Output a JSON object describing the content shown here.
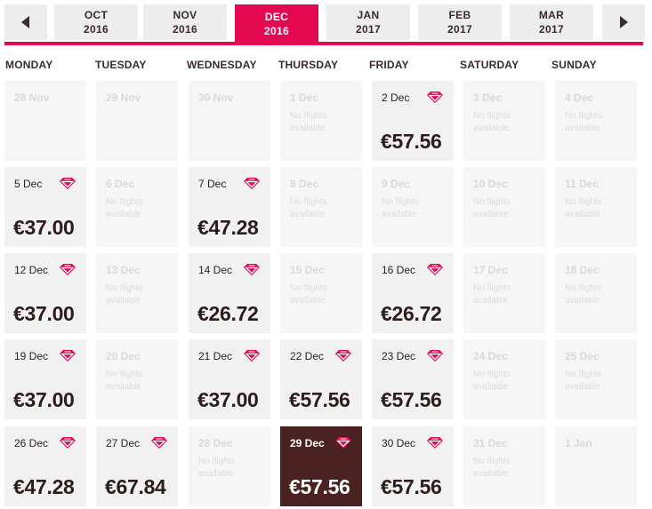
{
  "nav": {
    "prev_icon": "chevron-left-icon",
    "next_icon": "chevron-right-icon",
    "months": [
      {
        "month": "OCT",
        "year": "2016",
        "active": false
      },
      {
        "month": "NOV",
        "year": "2016",
        "active": false
      },
      {
        "month": "DEC",
        "year": "2016",
        "active": true
      },
      {
        "month": "JAN",
        "year": "2017",
        "active": false
      },
      {
        "month": "FEB",
        "year": "2017",
        "active": false
      },
      {
        "month": "MAR",
        "year": "2017",
        "active": false
      }
    ]
  },
  "weekdays": [
    "MONDAY",
    "TUESDAY",
    "WEDNESDAY",
    "THURSDAY",
    "FRIDAY",
    "SATURDAY",
    "SUNDAY"
  ],
  "no_flights_text": "No flights available",
  "colors": {
    "accent": "#e3084f",
    "selected": "#4a2222",
    "gem": "#e3084f"
  },
  "weeks": [
    [
      {
        "date": "28 Nov",
        "state": "outside"
      },
      {
        "date": "29 Nov",
        "state": "outside"
      },
      {
        "date": "30 Nov",
        "state": "outside"
      },
      {
        "date": "1 Dec",
        "state": "none"
      },
      {
        "date": "2 Dec",
        "state": "flight",
        "price": "€57.56"
      },
      {
        "date": "3 Dec",
        "state": "none"
      },
      {
        "date": "4 Dec",
        "state": "none"
      }
    ],
    [
      {
        "date": "5 Dec",
        "state": "flight",
        "price": "€37.00"
      },
      {
        "date": "6 Dec",
        "state": "none"
      },
      {
        "date": "7 Dec",
        "state": "flight",
        "price": "€47.28"
      },
      {
        "date": "8 Dec",
        "state": "none"
      },
      {
        "date": "9 Dec",
        "state": "none"
      },
      {
        "date": "10 Dec",
        "state": "none"
      },
      {
        "date": "11 Dec",
        "state": "none"
      }
    ],
    [
      {
        "date": "12 Dec",
        "state": "flight",
        "price": "€37.00"
      },
      {
        "date": "13 Dec",
        "state": "none"
      },
      {
        "date": "14 Dec",
        "state": "flight",
        "price": "€26.72"
      },
      {
        "date": "15 Dec",
        "state": "none"
      },
      {
        "date": "16 Dec",
        "state": "flight",
        "price": "€26.72"
      },
      {
        "date": "17 Dec",
        "state": "none"
      },
      {
        "date": "18 Dec",
        "state": "none"
      }
    ],
    [
      {
        "date": "19 Dec",
        "state": "flight",
        "price": "€37.00"
      },
      {
        "date": "20 Dec",
        "state": "none"
      },
      {
        "date": "21 Dec",
        "state": "flight",
        "price": "€37.00"
      },
      {
        "date": "22 Dec",
        "state": "flight",
        "price": "€57.56"
      },
      {
        "date": "23 Dec",
        "state": "flight",
        "price": "€57.56"
      },
      {
        "date": "24 Dec",
        "state": "none"
      },
      {
        "date": "25 Dec",
        "state": "none"
      }
    ],
    [
      {
        "date": "26 Dec",
        "state": "flight",
        "price": "€47.28"
      },
      {
        "date": "27 Dec",
        "state": "flight",
        "price": "€67.84"
      },
      {
        "date": "28 Dec",
        "state": "none"
      },
      {
        "date": "29 Dec",
        "state": "selected",
        "price": "€57.56"
      },
      {
        "date": "30 Dec",
        "state": "flight",
        "price": "€57.56"
      },
      {
        "date": "31 Dec",
        "state": "none"
      },
      {
        "date": "1 Jan",
        "state": "outside"
      }
    ]
  ]
}
